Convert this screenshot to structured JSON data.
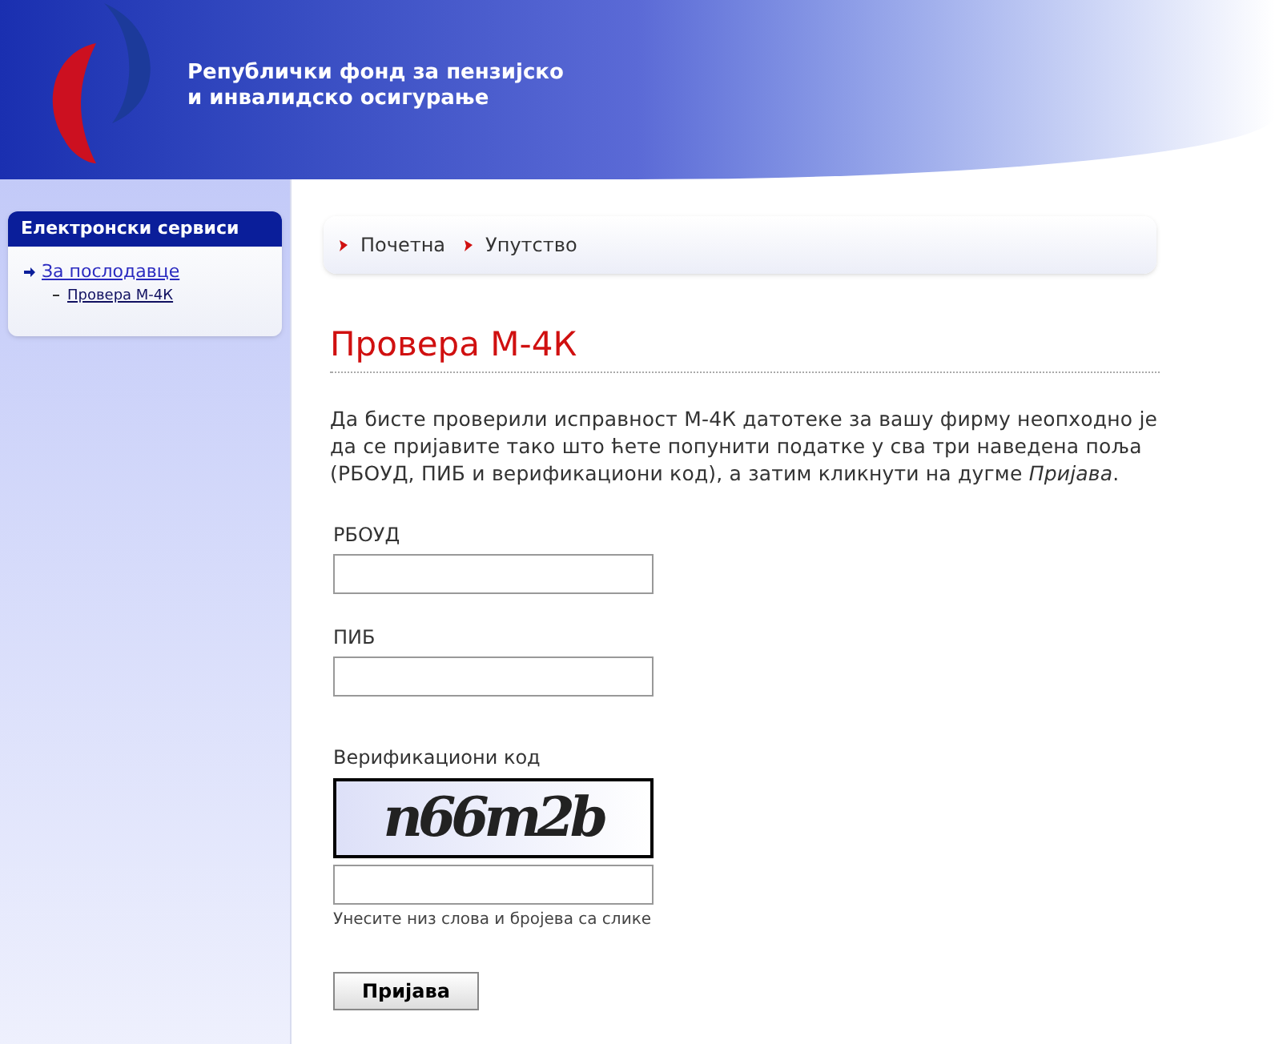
{
  "header": {
    "title_line_1": "Републички фонд за пензијско",
    "title_line_2": "и инвалидско осигурање"
  },
  "sidebar": {
    "title": "Електронски сервиси",
    "items": [
      {
        "label": "За послодавце",
        "children": [
          {
            "label": "Провера М-4К"
          }
        ]
      }
    ]
  },
  "breadcrumb": [
    "Почетна",
    "Упутство"
  ],
  "page_title": "Провера М-4К",
  "intro": "Да бисте проверили исправност М-4К датотеке за вашу фирму неопходно је да се пријавите тако што ћете попунити податке у сва три наведена поља (РБОУД, ПИБ и верификациони код), а затим кликнути на дугме *Пријава*.",
  "fields": [
    {
      "label": "РБОУД"
    },
    {
      "label": "ПИБ"
    }
  ],
  "verification": {
    "label": "Верификациони код",
    "captcha_text": "n66m2b",
    "hint": "Унесите низ слова и бројева са слике"
  },
  "submit_button": "Пријава"
}
